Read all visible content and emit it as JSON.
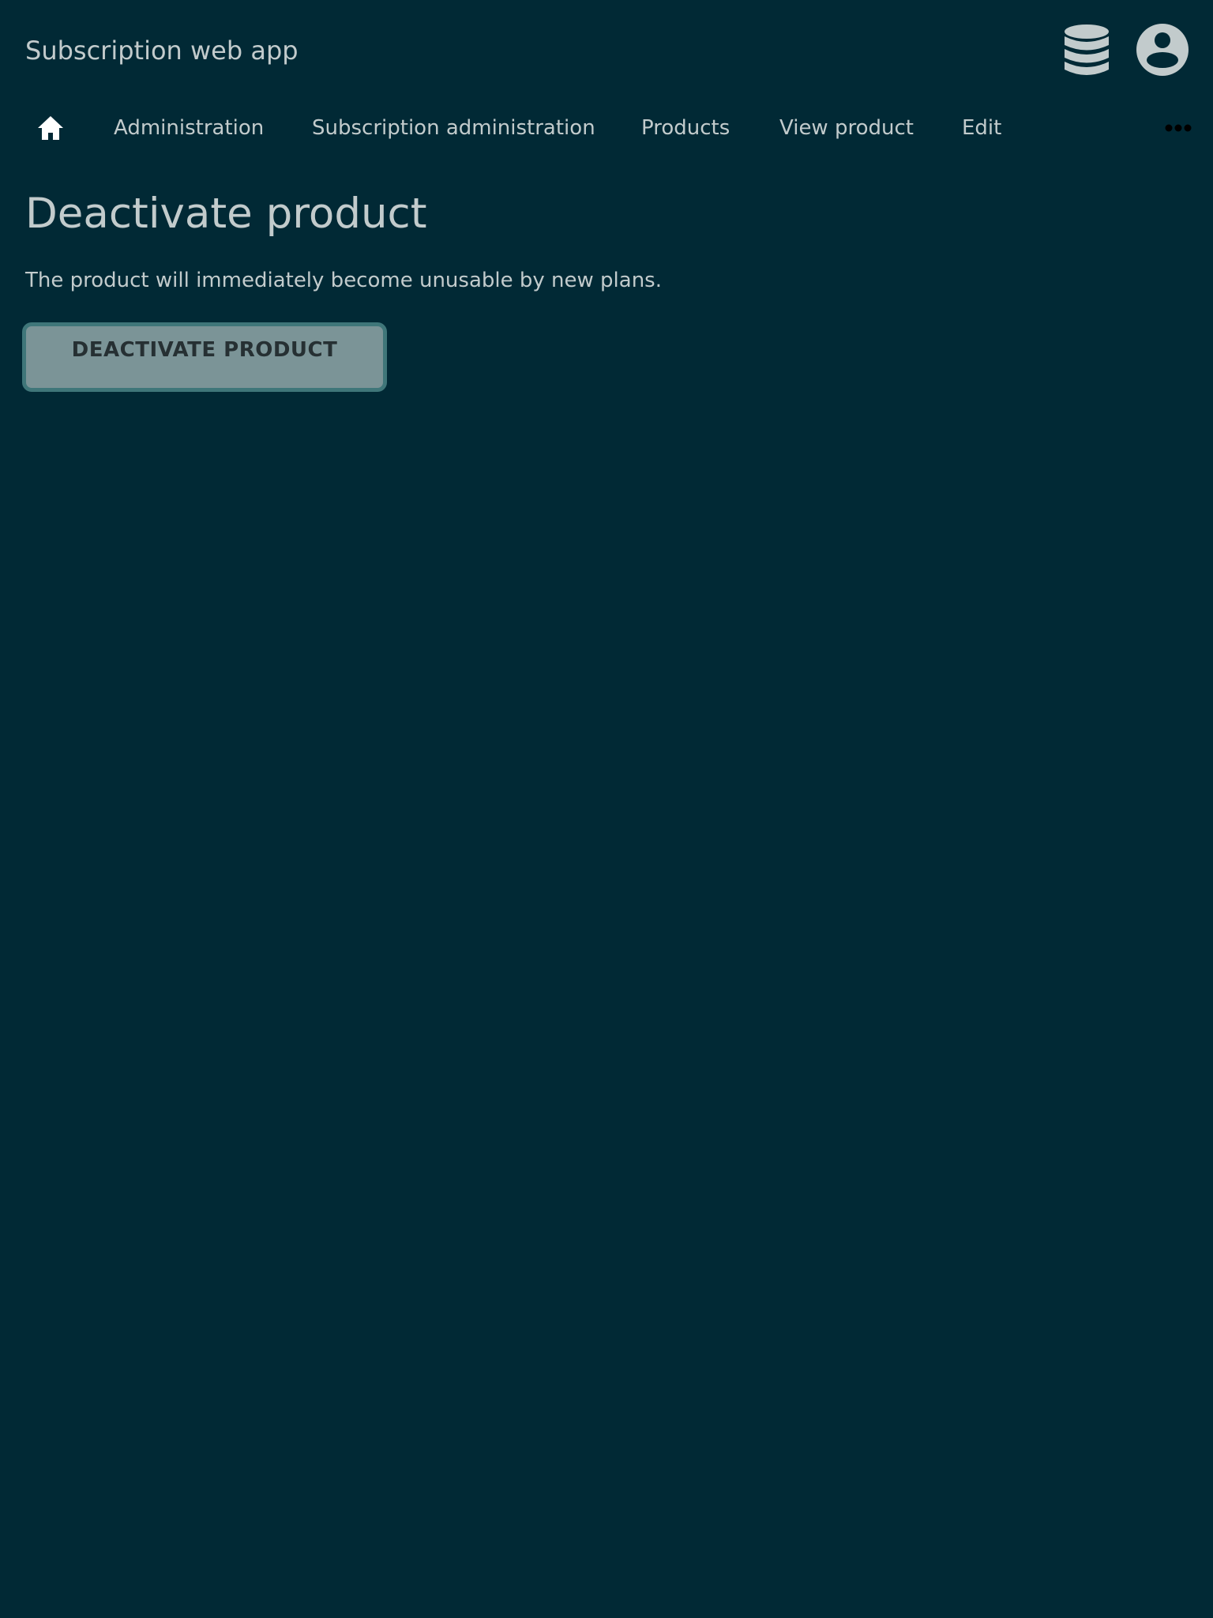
{
  "header": {
    "app_title": "Subscription web app",
    "icons": [
      "database-icon",
      "account-circle-icon"
    ]
  },
  "breadcrumb": {
    "home_icon": "home-icon",
    "items": [
      {
        "label": "Administration"
      },
      {
        "label": "Subscription administration"
      },
      {
        "label": "Products"
      },
      {
        "label": "View product"
      },
      {
        "label": "Edit"
      }
    ],
    "more_icon": "more-horizontal-icon"
  },
  "main": {
    "title": "Deactivate product",
    "description": "The product will immediately become unusable by new plans.",
    "deactivate_label": "DEACTIVATE PRODUCT"
  },
  "colors": {
    "background": "#012935",
    "text": "#c2cbcc",
    "button_fill": "#7b9497",
    "button_border": "#3f7679",
    "button_text": "#263033"
  }
}
